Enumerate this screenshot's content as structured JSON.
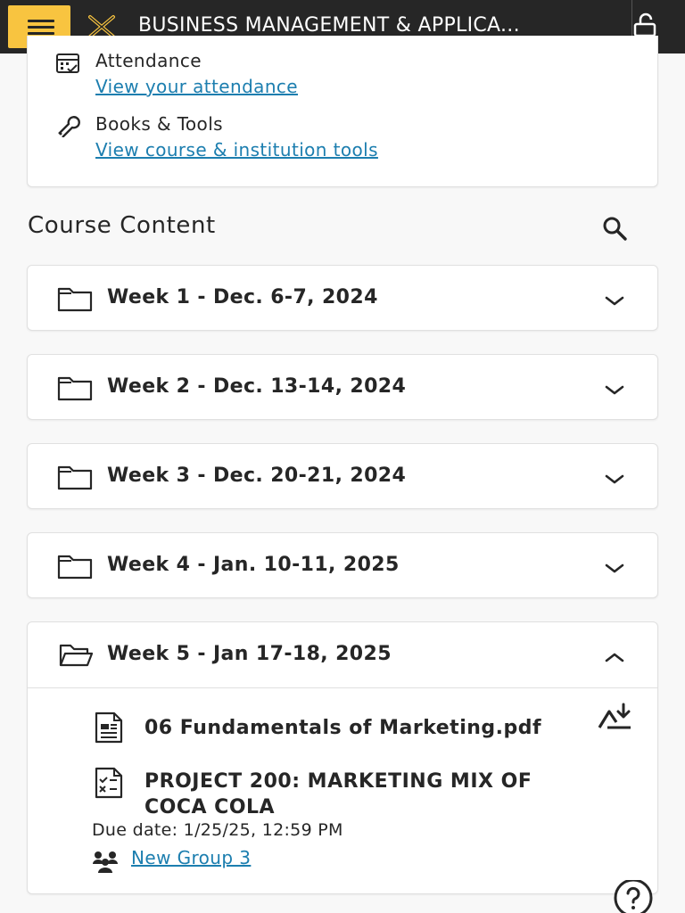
{
  "header": {
    "title": "BUSINESS MANAGEMENT & APPLICA...",
    "menu_icon": "hamburger-icon",
    "logo_icon": "x-logo-icon",
    "lock_icon": "unlock-icon",
    "accent_color": "#f8c440",
    "bar_color": "#262626"
  },
  "tools": {
    "attendance": {
      "title": "Attendance",
      "link": "View your attendance",
      "icon": "attendance-calendar-icon"
    },
    "books": {
      "title": "Books & Tools",
      "link": "View course & institution tools",
      "icon": "wrench-icon"
    },
    "link_color": "#1c7eaf"
  },
  "course_content": {
    "title": "Course Content",
    "search_icon": "search-icon",
    "weeks": [
      {
        "title": "Week 1 - Dec. 6-7, 2024",
        "expanded": false
      },
      {
        "title": "Week 2 - Dec. 13-14, 2024",
        "expanded": false
      },
      {
        "title": "Week 3 - Dec. 20-21, 2024",
        "expanded": false
      },
      {
        "title": "Week 4 - Jan. 10-11, 2025",
        "expanded": false
      },
      {
        "title": "Week 5 - Jan 17-18, 2025",
        "expanded": true
      }
    ],
    "week5_items": {
      "document": {
        "title": "06 Fundamentals of Marketing.pdf",
        "icon": "document-icon",
        "action_icon": "download-icon"
      },
      "assignment": {
        "title_line1": "PROJECT 200: MARKETING MIX OF",
        "title_line2": "COCA COLA",
        "due": "Due date: 1/25/25, 12:59 PM",
        "group_link": "New Group 3",
        "icon": "assignment-checklist-icon",
        "group_icon": "group-icon"
      }
    }
  },
  "help_icon": "help-question-icon"
}
